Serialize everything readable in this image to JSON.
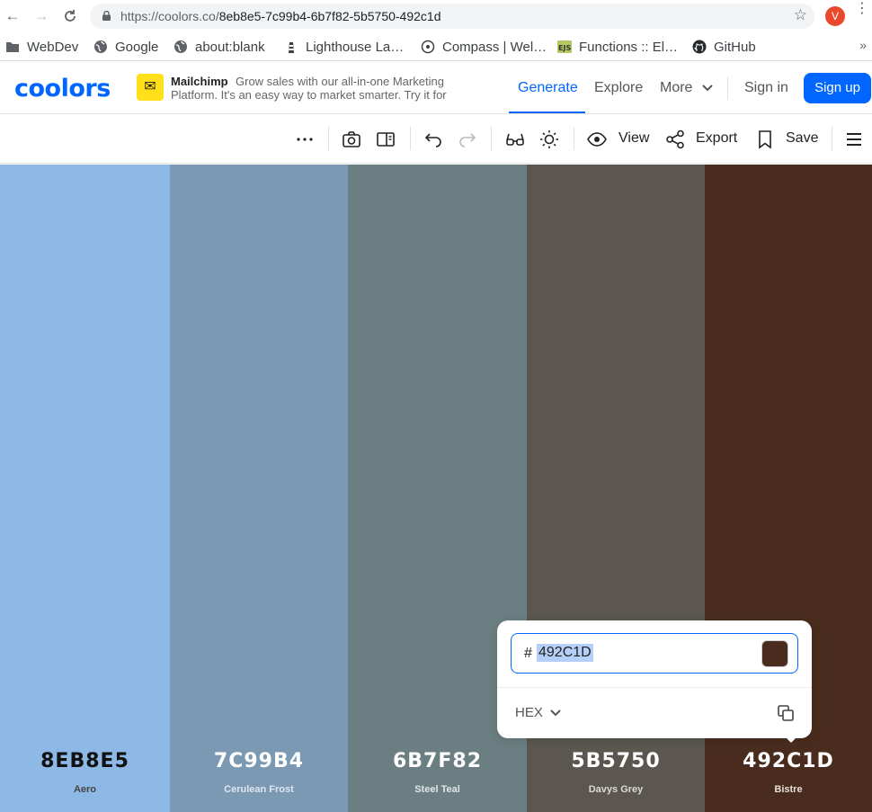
{
  "browser": {
    "url_host": "https://coolors.co/",
    "url_path": "8eb8e5-7c99b4-6b7f82-5b5750-492c1d",
    "avatar_letter": "V",
    "bookmarks": [
      {
        "label": "WebDev",
        "icon": "folder-icon"
      },
      {
        "label": "Google",
        "icon": "globe-icon"
      },
      {
        "label": "about:blank",
        "icon": "globe-icon"
      },
      {
        "label": "Lighthouse La…",
        "icon": "lighthouse-icon"
      },
      {
        "label": "Compass | Wel…",
        "icon": "compass-icon"
      },
      {
        "label": "Functions :: El…",
        "icon": "ejs-icon"
      },
      {
        "label": "GitHub",
        "icon": "github-icon"
      }
    ],
    "bookmark_more": "»"
  },
  "header": {
    "logo": "coolors",
    "ad": {
      "brand": "Mailchimp",
      "text": "Grow sales with our all-in-one Marketing Platform. It's an easy way to market smarter. Try it for"
    },
    "nav": {
      "generate": "Generate",
      "explore": "Explore",
      "more": "More",
      "signin": "Sign in",
      "signup": "Sign up"
    }
  },
  "toolbar": {
    "view": "View",
    "export": "Export",
    "save": "Save"
  },
  "palette": [
    {
      "hex": "8EB8E5",
      "name": "Aero",
      "color": "#8eb8e5",
      "text_color": "#111111",
      "name_color": "#444444"
    },
    {
      "hex": "7C99B4",
      "name": "Cerulean Frost",
      "color": "#7c99b4",
      "text_color": "#ffffff",
      "name_color": "#e0e6ee"
    },
    {
      "hex": "6B7F82",
      "name": "Steel Teal",
      "color": "#6b7f82",
      "text_color": "#ffffff",
      "name_color": "#e0e6e6"
    },
    {
      "hex": "5B5750",
      "name": "Davys Grey",
      "color": "#5b5750",
      "text_color": "#ffffff",
      "name_color": "#dcdad6"
    },
    {
      "hex": "492C1D",
      "name": "Bistre",
      "color": "#492c1d",
      "text_color": "#ffffff",
      "name_color": "#e6ddd8"
    }
  ],
  "picker": {
    "hash": "#",
    "value": "492C1D",
    "swatch_color": "#492c1d",
    "mode": "HEX"
  }
}
